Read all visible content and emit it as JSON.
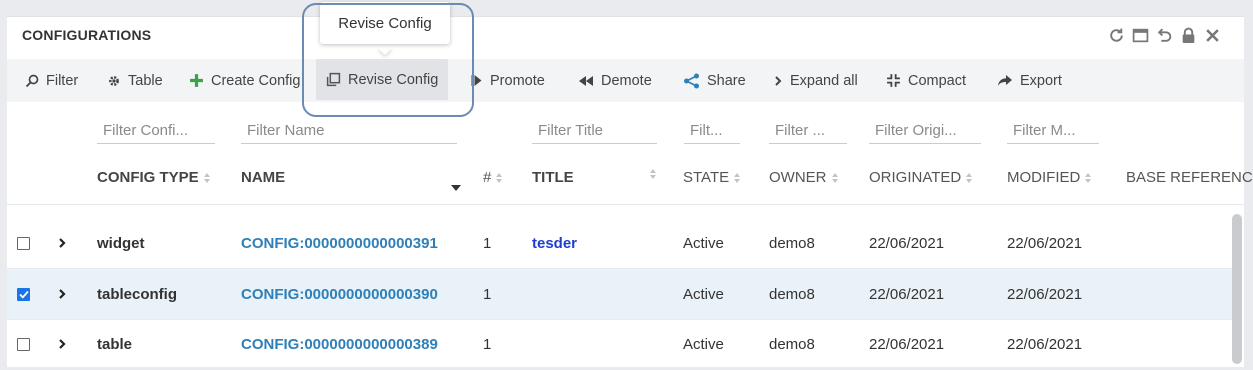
{
  "panel": {
    "title": "CONFIGURATIONS"
  },
  "window_icons": [
    "refresh-icon",
    "maximize-icon",
    "undo-icon",
    "lock-icon",
    "close-icon"
  ],
  "toolbar": {
    "filter": "Filter",
    "table": "Table",
    "create_config": "Create Config",
    "revise_config": "Revise Config",
    "promote": "Promote",
    "demote": "Demote",
    "share": "Share",
    "expand_all": "Expand all",
    "compact": "Compact",
    "export": "Export"
  },
  "tooltip": {
    "text": "Revise Config"
  },
  "filters": {
    "config_type": "Filter Confi...",
    "name": "Filter Name",
    "title": "Filter Title",
    "state": "Filt...",
    "owner": "Filter ...",
    "originated": "Filter Origi...",
    "modified": "Filter M..."
  },
  "columns": {
    "config_type": "CONFIG TYPE",
    "name": "NAME",
    "rev": "#",
    "title": "TITLE",
    "state": "STATE",
    "owner": "OWNER",
    "originated": "ORIGINATED",
    "modified": "MODIFIED",
    "base_reference": "BASE REFERENC"
  },
  "rows": [
    {
      "checked": false,
      "type": "widget",
      "name": "CONFIG:0000000000000391",
      "rev": "1",
      "title": "tesder",
      "state": "Active",
      "owner": "demo8",
      "originated": "22/06/2021",
      "modified": "22/06/2021"
    },
    {
      "checked": true,
      "type": "tableconfig",
      "name": "CONFIG:0000000000000390",
      "rev": "1",
      "title": "",
      "state": "Active",
      "owner": "demo8",
      "originated": "22/06/2021",
      "modified": "22/06/2021"
    },
    {
      "checked": false,
      "type": "table",
      "name": "CONFIG:0000000000000389",
      "rev": "1",
      "title": "",
      "state": "Active",
      "owner": "demo8",
      "originated": "22/06/2021",
      "modified": "22/06/2021"
    }
  ],
  "colors": {
    "link": "#2f7fb8",
    "title_link": "#1e3fcf",
    "checkbox_on": "#1a73e8",
    "create_plus": "#3aa34a",
    "selected_row": "#e9f2f8"
  }
}
